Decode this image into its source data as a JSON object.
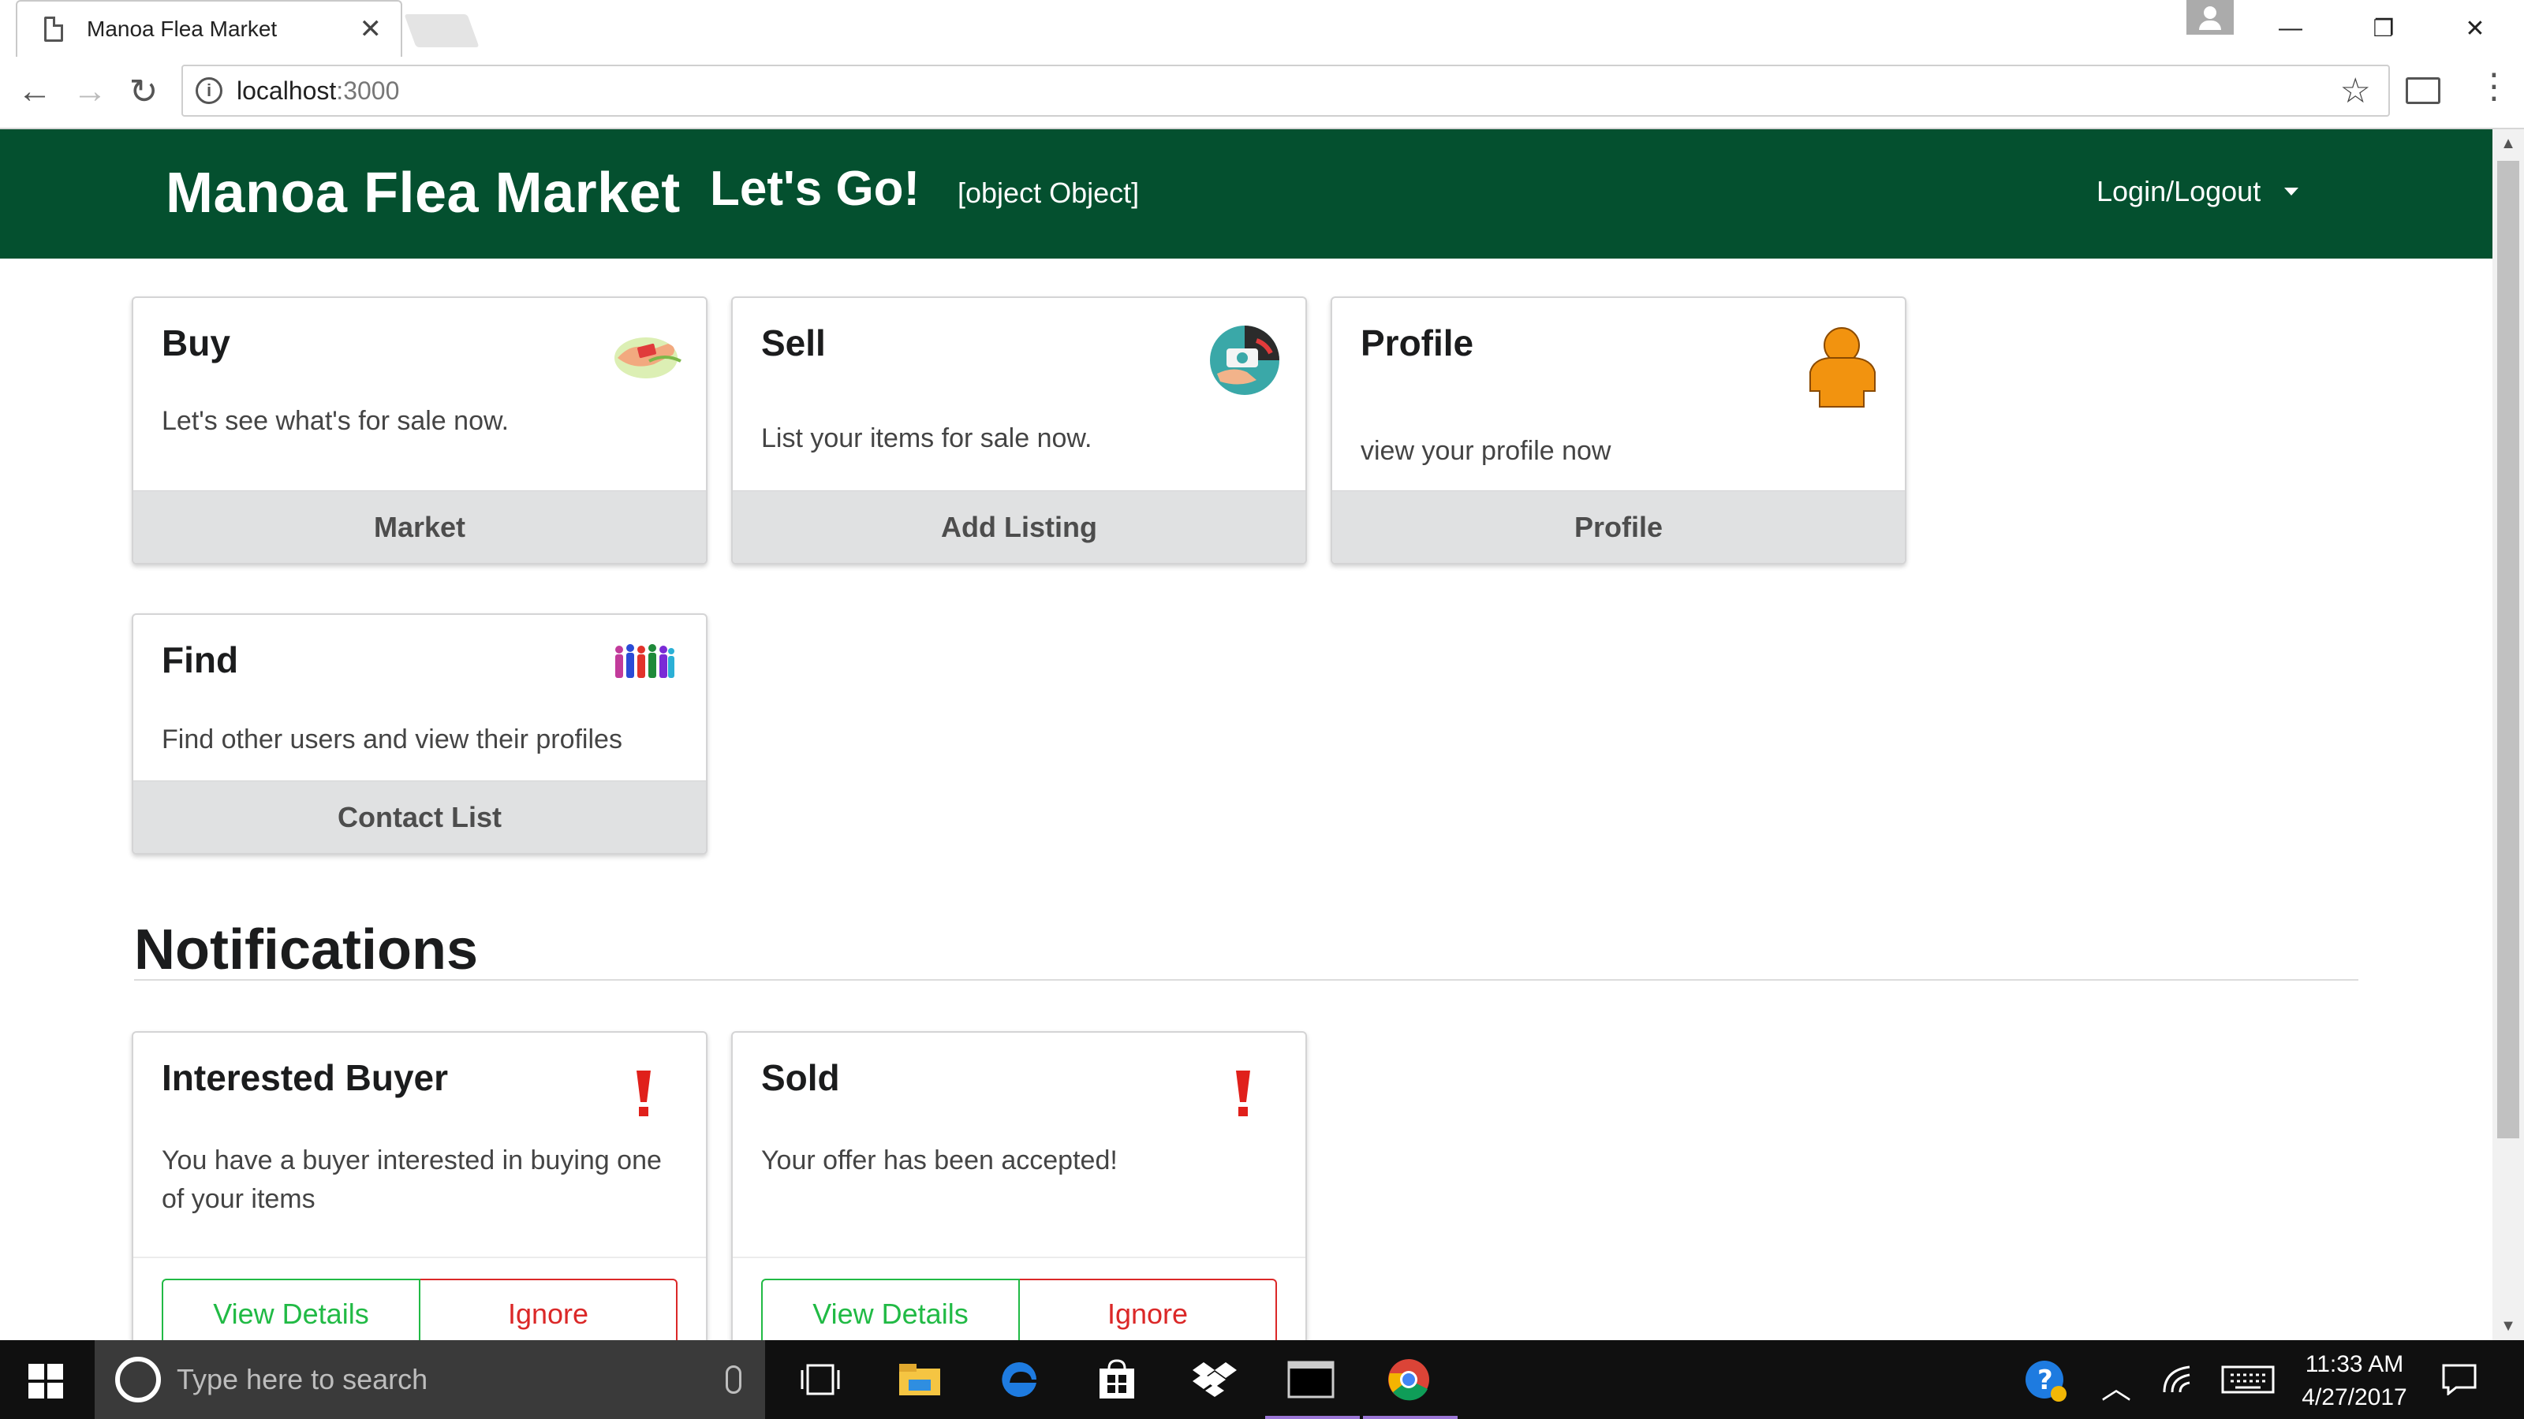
{
  "browser": {
    "tab_title": "Manoa Flea Market",
    "tab_close": "✕",
    "url_host": "localhost",
    "url_port": ":3000",
    "window_controls": {
      "minimize": "—",
      "restore": "❐",
      "close": "✕"
    }
  },
  "site_nav": {
    "brand": "Manoa Flea Market",
    "lets_go": "Let's Go!",
    "object_text": "[object Object]",
    "login_logout": "Login/Logout"
  },
  "cards": [
    {
      "header": "Buy",
      "description": "Let's see what's for sale now.",
      "button": "Market",
      "icon": "hands-exchange-icon"
    },
    {
      "header": "Sell",
      "description": "List your items for sale now.",
      "button": "Add Listing",
      "icon": "money-exchange-icon"
    },
    {
      "header": "Profile",
      "description": "view your profile now",
      "button": "Profile",
      "icon": "person-icon"
    },
    {
      "header": "Find",
      "description": "Find other users and view their profiles",
      "button": "Contact List",
      "icon": "people-group-icon"
    }
  ],
  "notifications": {
    "title": "Notifications",
    "items": [
      {
        "header": "Interested Buyer",
        "description": "You have a buyer interested in buying one of your items",
        "view_label": "View Details",
        "ignore_label": "Ignore"
      },
      {
        "header": "Sold",
        "description": "Your offer has been accepted!",
        "view_label": "View Details",
        "ignore_label": "Ignore"
      }
    ]
  },
  "taskbar": {
    "search_placeholder": "Type here to search",
    "time": "11:33 AM",
    "date": "4/27/2017"
  },
  "colors": {
    "nav_green": "#04502f",
    "success": "#21ba45",
    "danger": "#db2828",
    "alert_red": "#e0201b"
  }
}
